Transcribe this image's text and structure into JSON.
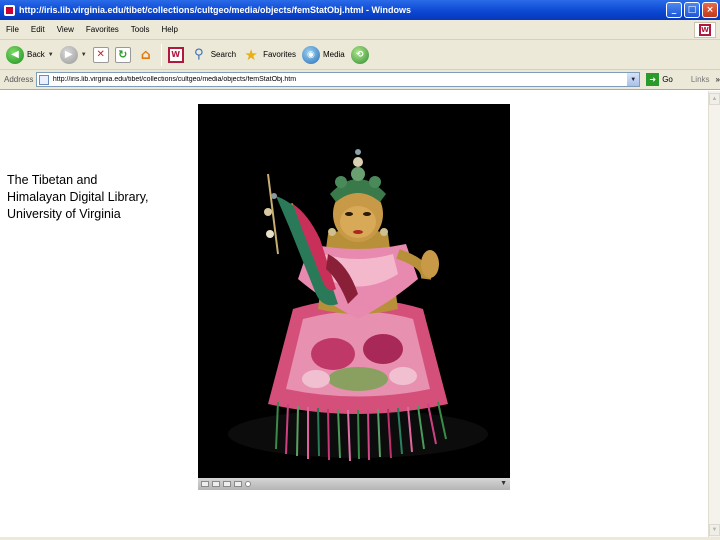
{
  "window": {
    "title": "http://iris.lib.virginia.edu/tibet/collections/cultgeo/media/objects/femStatObj.html - Windows",
    "controls": {
      "minimize": "_",
      "maximize": "□",
      "close": "×"
    }
  },
  "menubar": {
    "items": [
      "File",
      "Edit",
      "View",
      "Favorites",
      "Tools",
      "Help"
    ],
    "brand_icon": "windows-logo-icon"
  },
  "toolbar": {
    "back_label": "Back",
    "search_label": "Search",
    "favorites_label": "Favorites",
    "media_label": "Media"
  },
  "address": {
    "label": "Address",
    "url": "http://iris.lib.virginia.edu/tibet/collections/cultgeo/media/objects/femStatObj.htm",
    "go_label": "Go",
    "links_label": "Links",
    "more": "»"
  },
  "page": {
    "caption": "The Tibetan and\n Himalayan Digital Library,\nUniversity of Virginia"
  },
  "image": {
    "subject": "tibetan-deity-statue-image",
    "background_color": "#000000"
  },
  "colors": {
    "titlebar": "#0a46d2",
    "chrome": "#ece9d8",
    "close_button": "#c0391b"
  }
}
